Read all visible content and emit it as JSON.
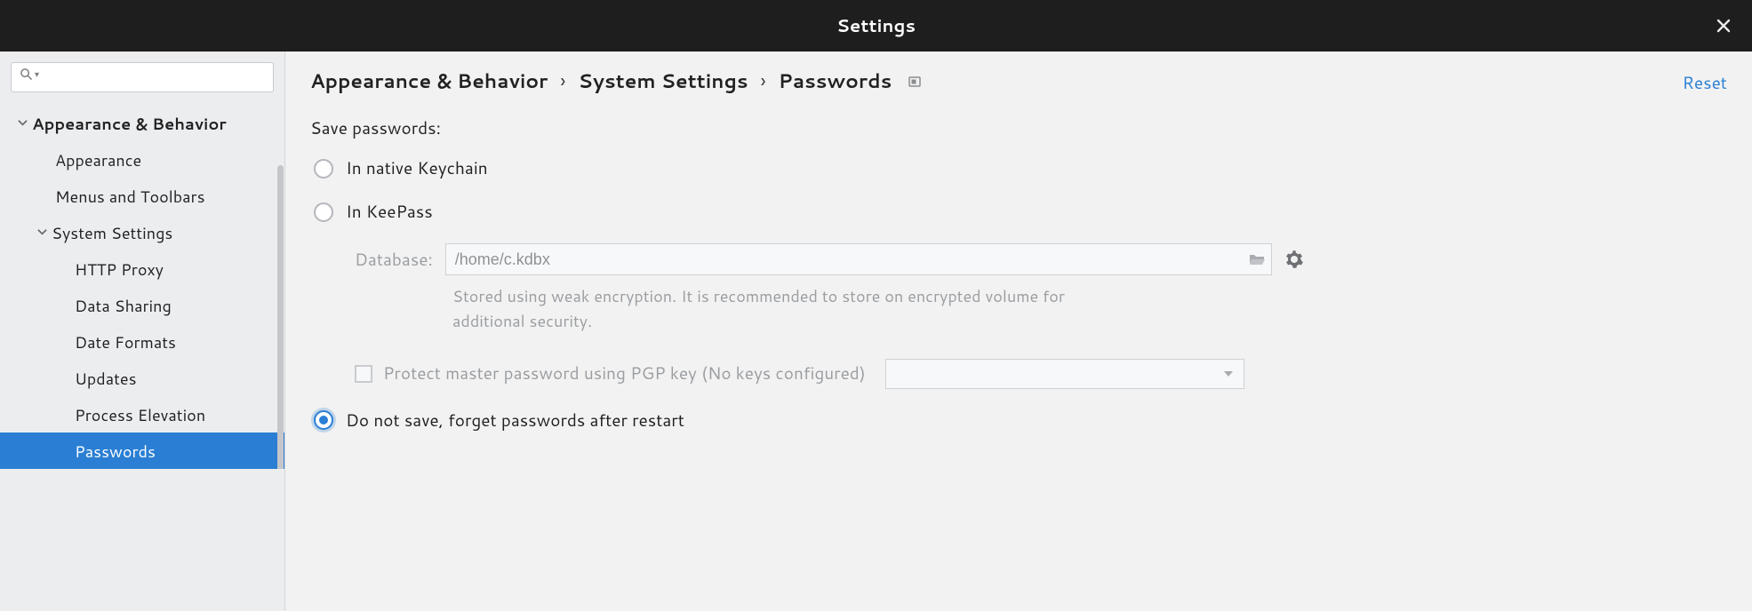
{
  "titlebar": {
    "title": "Settings"
  },
  "sidebar": {
    "items": {
      "appearance_behavior": "Appearance & Behavior",
      "appearance": "Appearance",
      "menus_toolbars": "Menus and Toolbars",
      "system_settings": "System Settings",
      "http_proxy": "HTTP Proxy",
      "data_sharing": "Data Sharing",
      "date_formats": "Date Formats",
      "updates": "Updates",
      "process_elevation": "Process Elevation",
      "passwords": "Passwords"
    }
  },
  "breadcrumb": {
    "a": "Appearance & Behavior",
    "b": "System Settings",
    "c": "Passwords"
  },
  "reset": "Reset",
  "section": {
    "label": "Save passwords:",
    "option_native": "In native Keychain",
    "option_keepass": "In KeePass",
    "database_label": "Database:",
    "database_value": "/home/c.kdbx",
    "database_hint": "Stored using weak encryption. It is recommended to store on encrypted volume for additional security.",
    "protect_label": "Protect master password using PGP key (No keys configured)",
    "option_nosave": "Do not save, forget passwords after restart"
  }
}
